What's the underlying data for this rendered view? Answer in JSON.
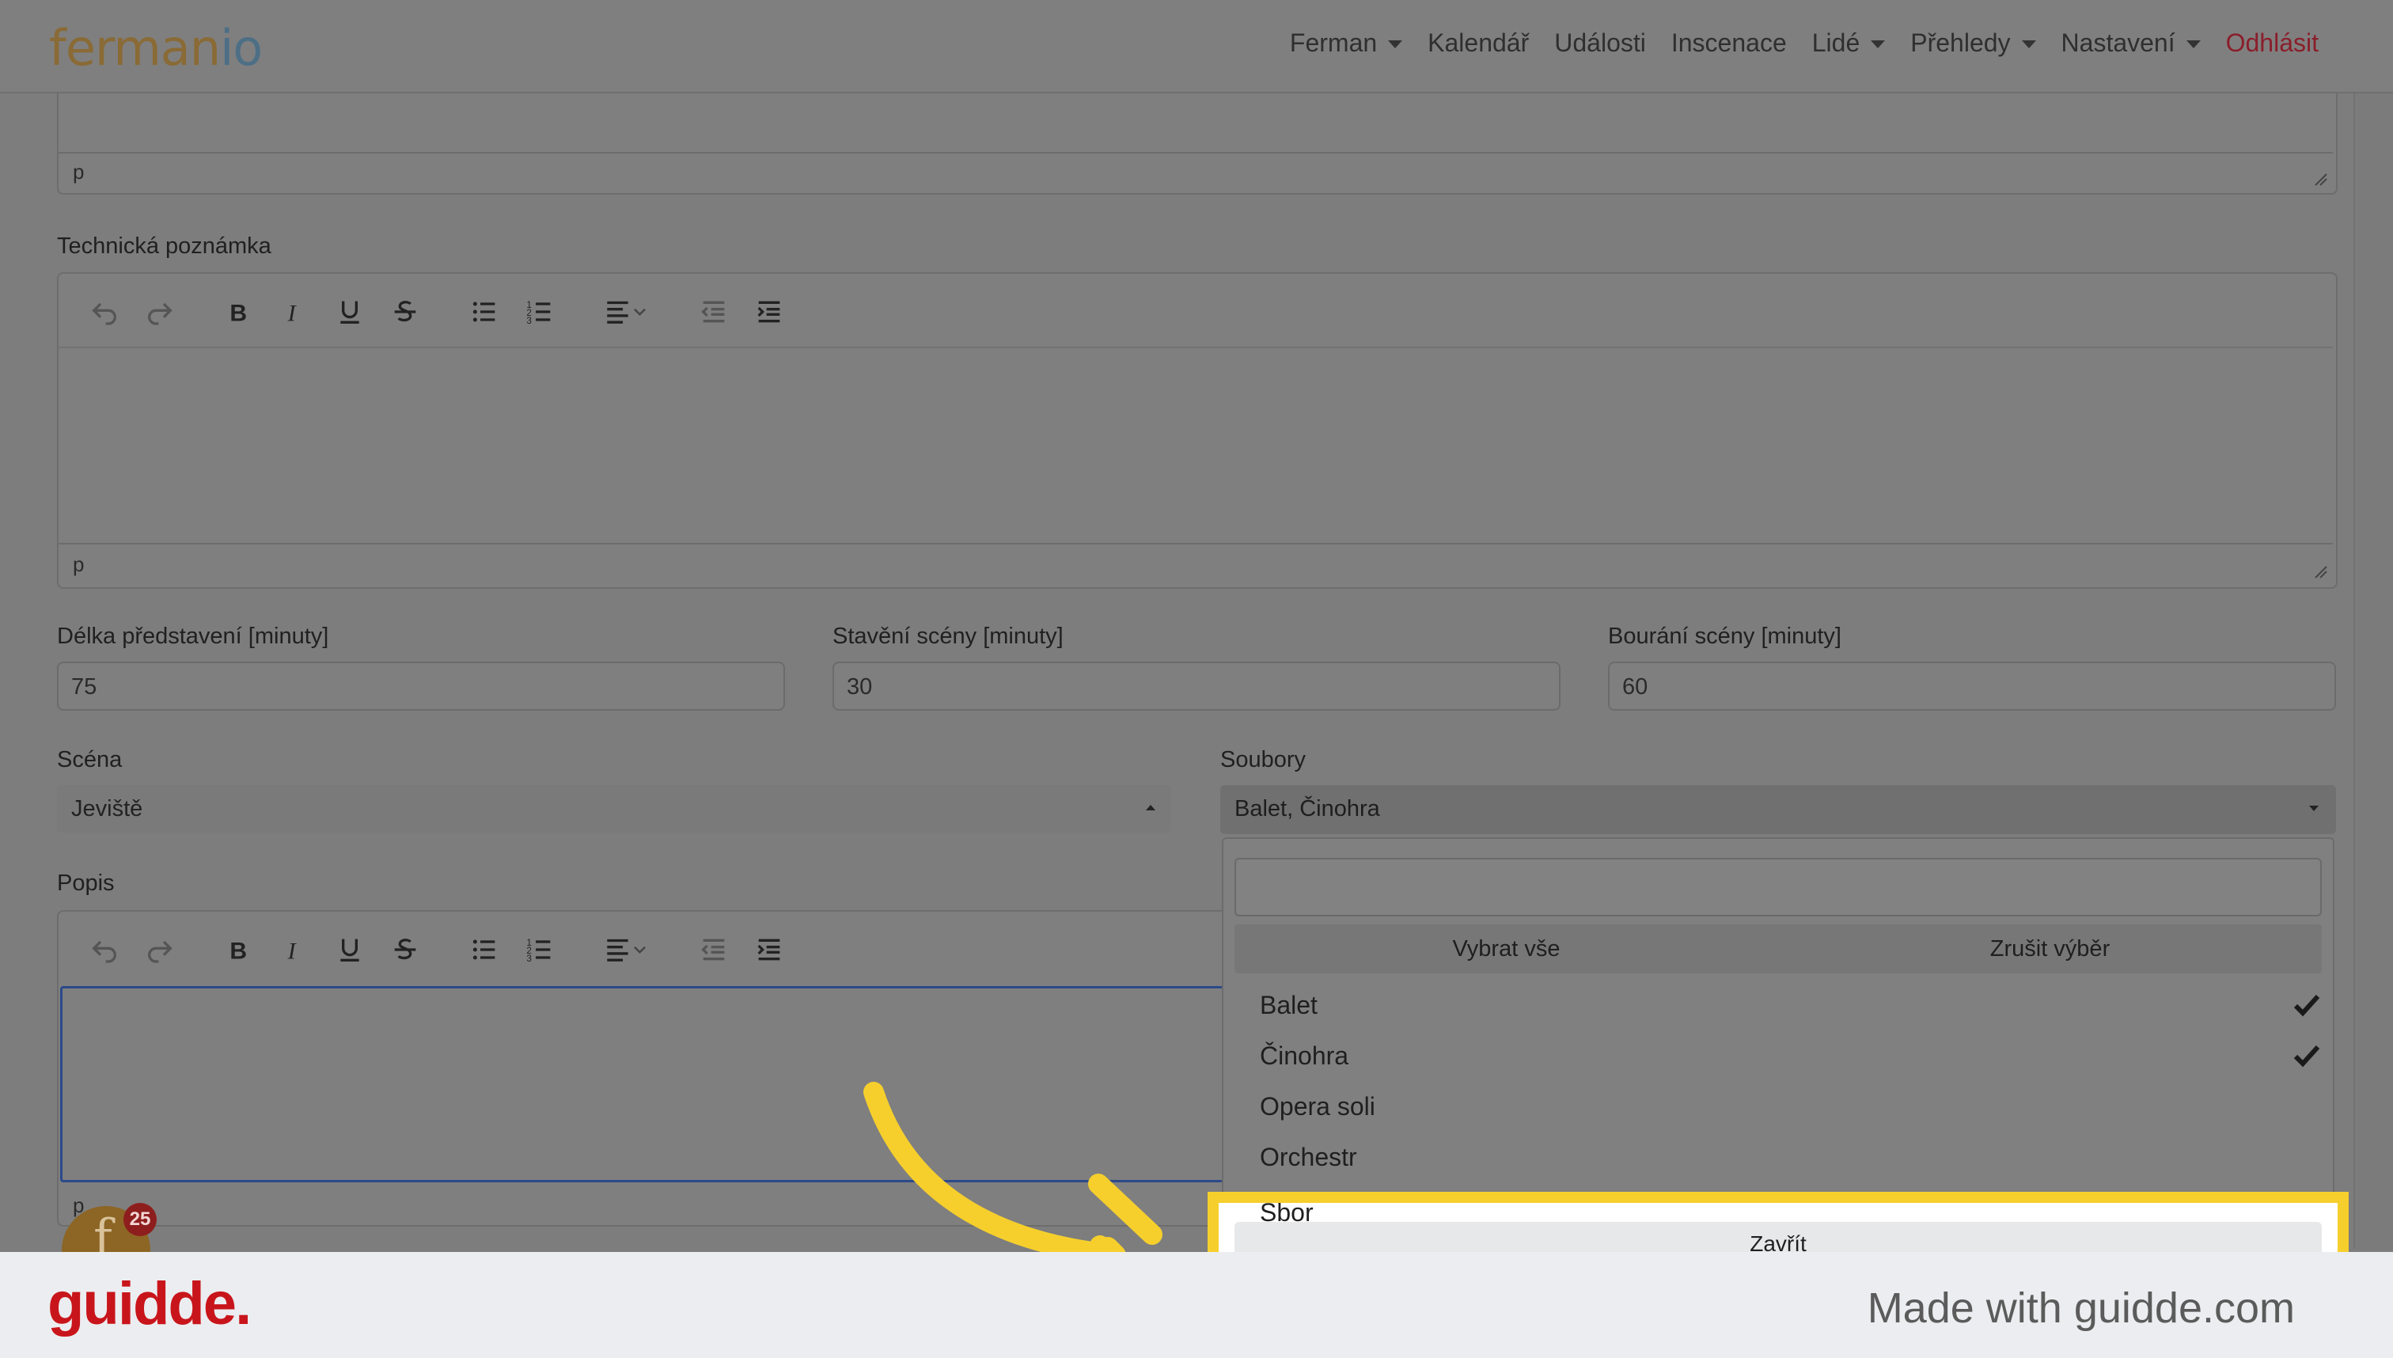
{
  "navbar": {
    "logo_part1": "ferman",
    "logo_part2": "io",
    "items": [
      {
        "label": "Ferman",
        "caret": true
      },
      {
        "label": "Kalendář",
        "caret": false
      },
      {
        "label": "Události",
        "caret": false
      },
      {
        "label": "Inscenace",
        "caret": false
      },
      {
        "label": "Lidé",
        "caret": true
      },
      {
        "label": "Přehledy",
        "caret": true
      },
      {
        "label": "Nastavení",
        "caret": true
      }
    ],
    "logout": "Odhlásit",
    "logout_color": "#8a1e2a"
  },
  "form": {
    "top_editor_status": "p",
    "tech_note": {
      "label": "Technická poznámka",
      "status": "p"
    },
    "duration": {
      "label": "Délka představení [minuty]",
      "value": "75"
    },
    "setup": {
      "label": "Stavění scény [minuty]",
      "value": "30"
    },
    "teardown": {
      "label": "Bourání scény [minuty]",
      "value": "60"
    },
    "scene": {
      "label": "Scéna",
      "value": "Jeviště"
    },
    "ensembles": {
      "label": "Soubory",
      "value": "Balet, Činohra"
    },
    "description": {
      "label": "Popis",
      "status": "p"
    }
  },
  "toolbar_icons": [
    "undo-icon",
    "redo-icon",
    "bold-icon",
    "italic-icon",
    "underline-icon",
    "strikethrough-icon",
    "bullet-list-icon",
    "numbered-list-icon",
    "align-icon",
    "outdent-icon",
    "indent-icon"
  ],
  "dropdown": {
    "search_value": "",
    "select_all": "Vybrat vše",
    "deselect_all": "Zrušit výběr",
    "options": [
      {
        "label": "Balet",
        "selected": true
      },
      {
        "label": "Činohra",
        "selected": true
      },
      {
        "label": "Opera soli",
        "selected": false
      },
      {
        "label": "Orchestr",
        "selected": false
      },
      {
        "label": "Sbor",
        "selected": false
      }
    ],
    "close": "Zavřít"
  },
  "chat_badge": "25",
  "footer": {
    "brand": "guidde.",
    "made_with": "Made with guidde.com",
    "brand_color": "#c8151b"
  },
  "highlight_color": "#f6cf2d"
}
